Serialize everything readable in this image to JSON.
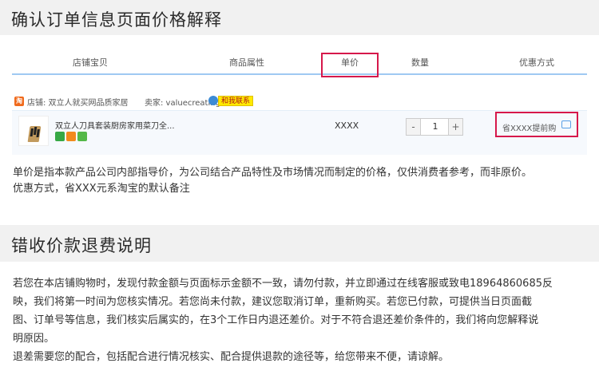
{
  "section1": {
    "title": "确认订单信息页面价格解释"
  },
  "table": {
    "headers": [
      "店铺宝贝",
      "商品属性",
      "单价",
      "数量",
      "优惠方式"
    ]
  },
  "shop": {
    "icon_text": "淘",
    "shop_label": "店铺: 双立人就买网品质家居",
    "seller_label": "卖家: valuecreating",
    "contact_label": "和我联系"
  },
  "order": {
    "product_title": "双立人刀具套装厨房家用菜刀全...",
    "price": "XXXX",
    "quantity": "1",
    "minus": "-",
    "plus": "+",
    "discount": "省XXXX提前购"
  },
  "explanation": {
    "line1": "单价是指本款产品公司内部指导价，为公司结合产品特性及市场情况而制定的价格，仅供消费者参考，而非原价。",
    "line2": "优惠方式，省XXX元系淘宝的默认备注"
  },
  "section2": {
    "title": "错收价款退费说明"
  },
  "refund": {
    "line1": "若您在本店铺购物时，发现付款金额与页面标示金额不一致，请勿付款，并立即通过在线客服或致电18964860685反",
    "line2": "映，我们将第一时间为您核实情况。若您尚未付款，建议您取消订单，重新购买。若您已付款，可提供当日页面截",
    "line3": "图、订单号等信息，我们核实后属实的，在3个工作日内退还差价。对于不符合退还差价条件的，我们将向您解释说",
    "line4": "明原因。",
    "line5": "退差需要您的配合，包括配合进行情况核实、配合提供退款的途径等，给您带来不便，请谅解。"
  },
  "colors": {
    "highlight": "#d6184b",
    "header_bg": "#f1f1f1",
    "accent_line": "#9fc9f2"
  }
}
